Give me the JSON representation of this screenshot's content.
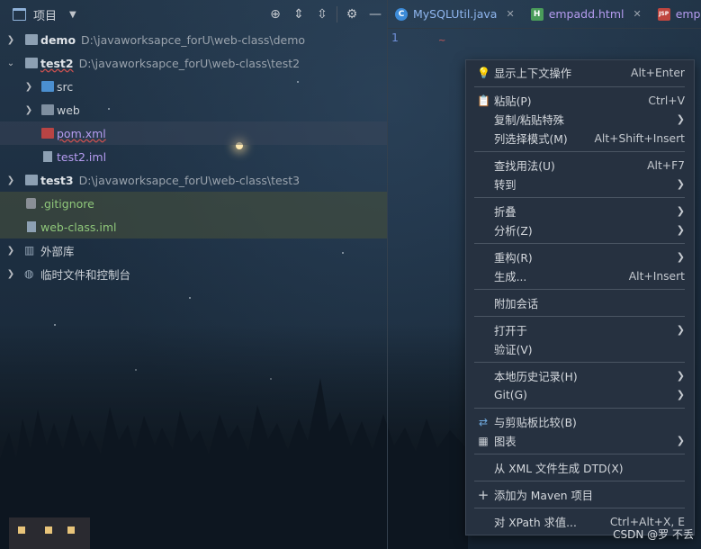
{
  "project_panel": {
    "title": "项目",
    "tree": [
      {
        "name": "demo",
        "path": "D:\\javaworksapce_forU\\web-class\\demo"
      },
      {
        "name": "test2",
        "path": "D:\\javaworksapce_forU\\web-class\\test2"
      },
      {
        "name": "src"
      },
      {
        "name": "web"
      },
      {
        "name": "pom.xml"
      },
      {
        "name": "test2.iml"
      },
      {
        "name": "test3",
        "path": "D:\\javaworksapce_forU\\web-class\\test3"
      },
      {
        "name": ".gitignore"
      },
      {
        "name": "web-class.iml"
      },
      {
        "name": "外部库"
      },
      {
        "name": "临时文件和控制台"
      }
    ]
  },
  "editor": {
    "tabs": [
      {
        "label": "MySQLUtil.java",
        "icon": "C",
        "color": "#3d8bd8"
      },
      {
        "label": "empadd.html",
        "icon": "H",
        "color": "#4a9c5a"
      },
      {
        "label": "emplist.js",
        "icon": "JSP",
        "color": "#c0463f"
      }
    ],
    "line_number": "1"
  },
  "context_menu": {
    "items": [
      {
        "label": "显示上下文操作",
        "shortcut": "Alt+Enter",
        "icon": "bulb-icon"
      },
      {
        "label": "粘贴(P)",
        "shortcut": "Ctrl+V",
        "icon": "clipboard-icon"
      },
      {
        "label": "复制/粘贴特殊",
        "submenu": true
      },
      {
        "label": "列选择模式(M)",
        "shortcut": "Alt+Shift+Insert"
      },
      {
        "label": "查找用法(U)",
        "shortcut": "Alt+F7"
      },
      {
        "label": "转到",
        "submenu": true
      },
      {
        "label": "折叠",
        "submenu": true
      },
      {
        "label": "分析(Z)",
        "submenu": true
      },
      {
        "label": "重构(R)",
        "submenu": true
      },
      {
        "label": "生成...",
        "shortcut": "Alt+Insert"
      },
      {
        "label": "附加会话"
      },
      {
        "label": "打开于",
        "submenu": true
      },
      {
        "label": "验证(V)"
      },
      {
        "label": "本地历史记录(H)",
        "submenu": true
      },
      {
        "label": "Git(G)",
        "submenu": true
      },
      {
        "label": "与剪贴板比较(B)",
        "icon": "compare-icon"
      },
      {
        "label": "图表",
        "submenu": true,
        "icon": "diagram-icon"
      },
      {
        "label": "从 XML 文件生成 DTD(X)"
      },
      {
        "label": "添加为 Maven 项目",
        "icon": "plus-icon"
      },
      {
        "label": "对 XPath 求值...",
        "shortcut": "Ctrl+Alt+X, E"
      }
    ]
  },
  "watermark": "CSDN @罗 不丢"
}
